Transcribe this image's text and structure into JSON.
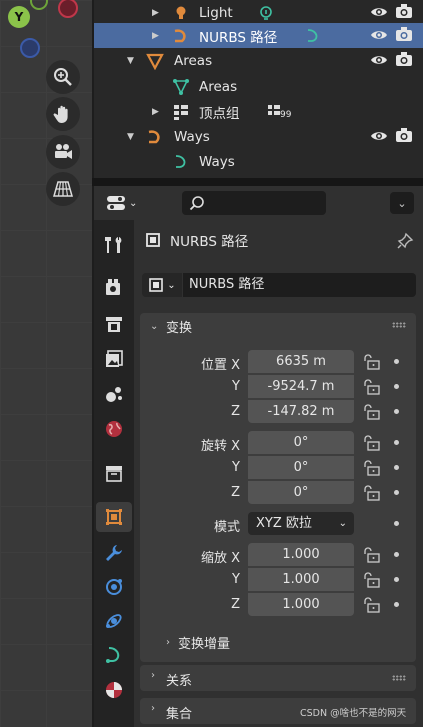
{
  "viewport": {
    "gizmo_y_label": "Y"
  },
  "outliner": {
    "rows": [
      {
        "label": "Light"
      },
      {
        "label": "NURBS 路径"
      },
      {
        "label": "Areas"
      },
      {
        "label": "Areas"
      },
      {
        "label": "顶点组",
        "badge": "99"
      },
      {
        "label": "Ways"
      },
      {
        "label": "Ways"
      }
    ]
  },
  "properties": {
    "object_title": "NURBS 路径",
    "object_name": "NURBS 路径",
    "transform": {
      "title": "变换",
      "location": {
        "label": "位置 X",
        "y_label": "Y",
        "z_label": "Z",
        "x": "6635 m",
        "y": "-9524.7 m",
        "z": "-147.82 m"
      },
      "rotation": {
        "label": "旋转 X",
        "y_label": "Y",
        "z_label": "Z",
        "x": "0°",
        "y": "0°",
        "z": "0°"
      },
      "mode": {
        "label": "模式",
        "value": "XYZ 欧拉"
      },
      "scale": {
        "label": "缩放 X",
        "y_label": "Y",
        "z_label": "Z",
        "x": "1.000",
        "y": "1.000",
        "z": "1.000"
      },
      "delta": "变换增量"
    },
    "relations_title": "关系",
    "collections_title": "集合"
  },
  "watermark": "CSDN @啥也不是的网天",
  "colors": {
    "accent_selected": "#4b6ba0",
    "curve_green": "#3fc1a3",
    "orange": "#e08a3c"
  }
}
